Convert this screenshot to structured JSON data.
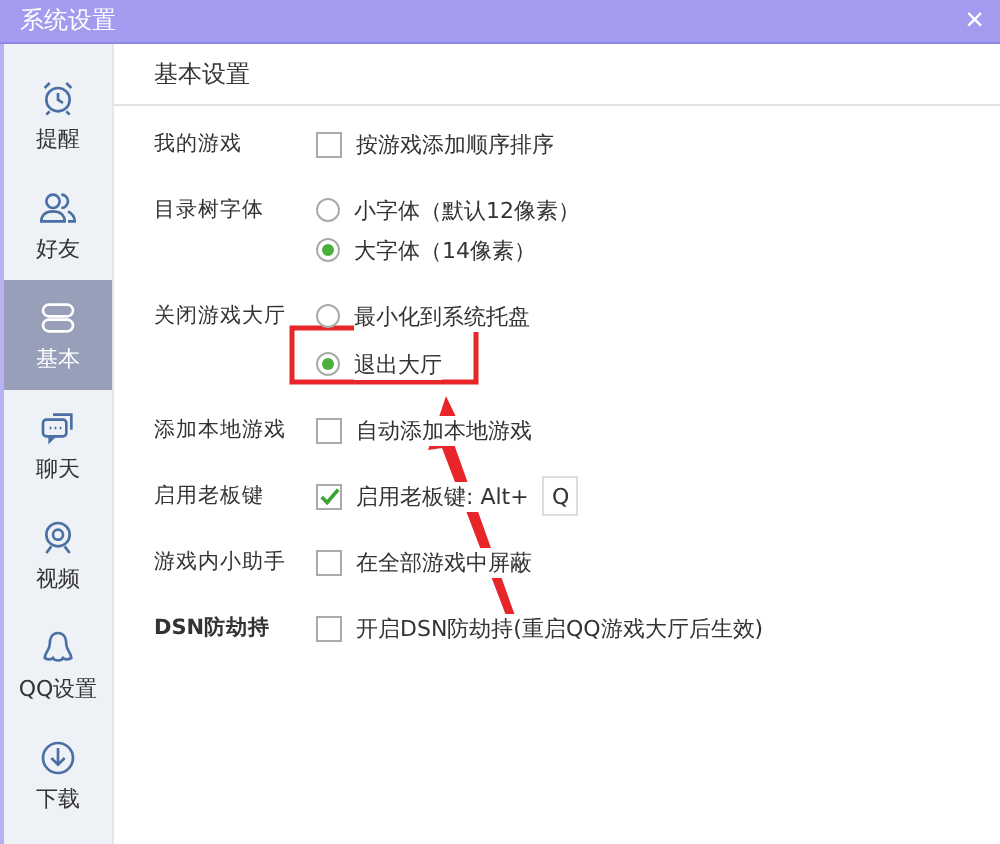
{
  "window": {
    "title": "系统设置",
    "close": "×"
  },
  "sidebar": {
    "items": [
      {
        "label": "提醒",
        "selected": false
      },
      {
        "label": "好友",
        "selected": false
      },
      {
        "label": "基本",
        "selected": true
      },
      {
        "label": "聊天",
        "selected": false
      },
      {
        "label": "视频",
        "selected": false
      },
      {
        "label": "QQ设置",
        "selected": false
      },
      {
        "label": "下载",
        "selected": false
      }
    ]
  },
  "section_title": "基本设置",
  "settings": [
    {
      "label": "我的游戏",
      "bold": false,
      "options": [
        {
          "kind": "checkbox",
          "text": "按游戏添加顺序排序",
          "checked": false
        }
      ]
    },
    {
      "label": "目录树字体",
      "bold": false,
      "options": [
        {
          "kind": "radio",
          "text": "小字体（默认12像素）",
          "selected": false
        },
        {
          "kind": "radio",
          "text": "大字体（14像素）",
          "selected": true
        }
      ]
    },
    {
      "label": "关闭游戏大厅",
      "bold": false,
      "options": [
        {
          "kind": "radio",
          "text": "最小化到系统托盘",
          "selected": false
        },
        {
          "kind": "radio",
          "text": "退出大厅",
          "selected": true
        }
      ]
    },
    {
      "label": "添加本地游戏",
      "bold": false,
      "options": [
        {
          "kind": "checkbox",
          "text": "自动添加本地游戏",
          "checked": false
        }
      ]
    },
    {
      "label": "启用老板键",
      "bold": false,
      "options": [
        {
          "kind": "hotkey",
          "text": "启用老板键: Alt+",
          "checked": true,
          "key": "Q"
        }
      ]
    },
    {
      "label": "游戏内小助手",
      "bold": false,
      "options": [
        {
          "kind": "checkbox",
          "text": "在全部游戏中屏蔽",
          "checked": false
        }
      ]
    },
    {
      "label": "DSN防劫持",
      "bold": true,
      "options": [
        {
          "kind": "checkbox",
          "text": "开启DSN防劫持(重启QQ游戏大厅后生效)",
          "checked": false
        }
      ]
    }
  ]
}
